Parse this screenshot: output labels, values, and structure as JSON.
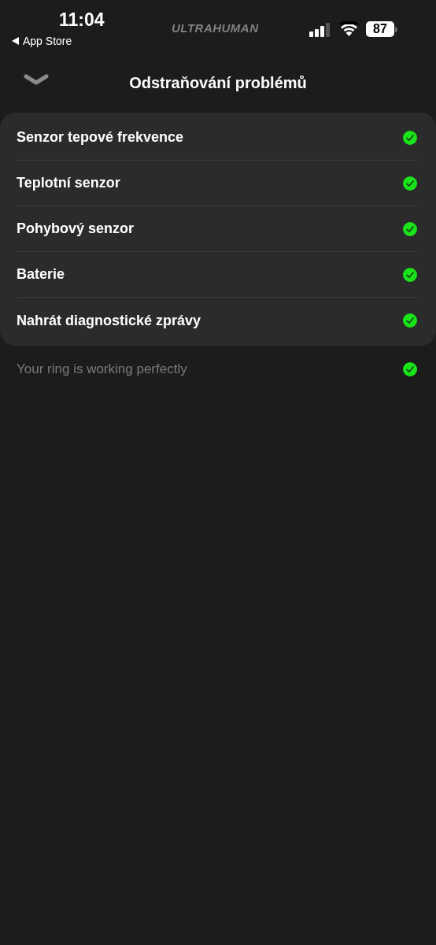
{
  "status_bar": {
    "time": "11:04",
    "back_app": "App Store",
    "app_banner": "ULTRAHUMAN",
    "battery": "87"
  },
  "header": {
    "title": "Odstraňování problémů"
  },
  "checks": [
    {
      "label": "Senzor tepové frekvence",
      "passed": true
    },
    {
      "label": "Teplotní senzor",
      "passed": true
    },
    {
      "label": "Pohybový senzor",
      "passed": true
    },
    {
      "label": "Baterie",
      "passed": true
    },
    {
      "label": "Nahrát diagnostické zprávy",
      "passed": true
    }
  ],
  "summary": {
    "text": "Your ring is working perfectly",
    "passed": true
  }
}
